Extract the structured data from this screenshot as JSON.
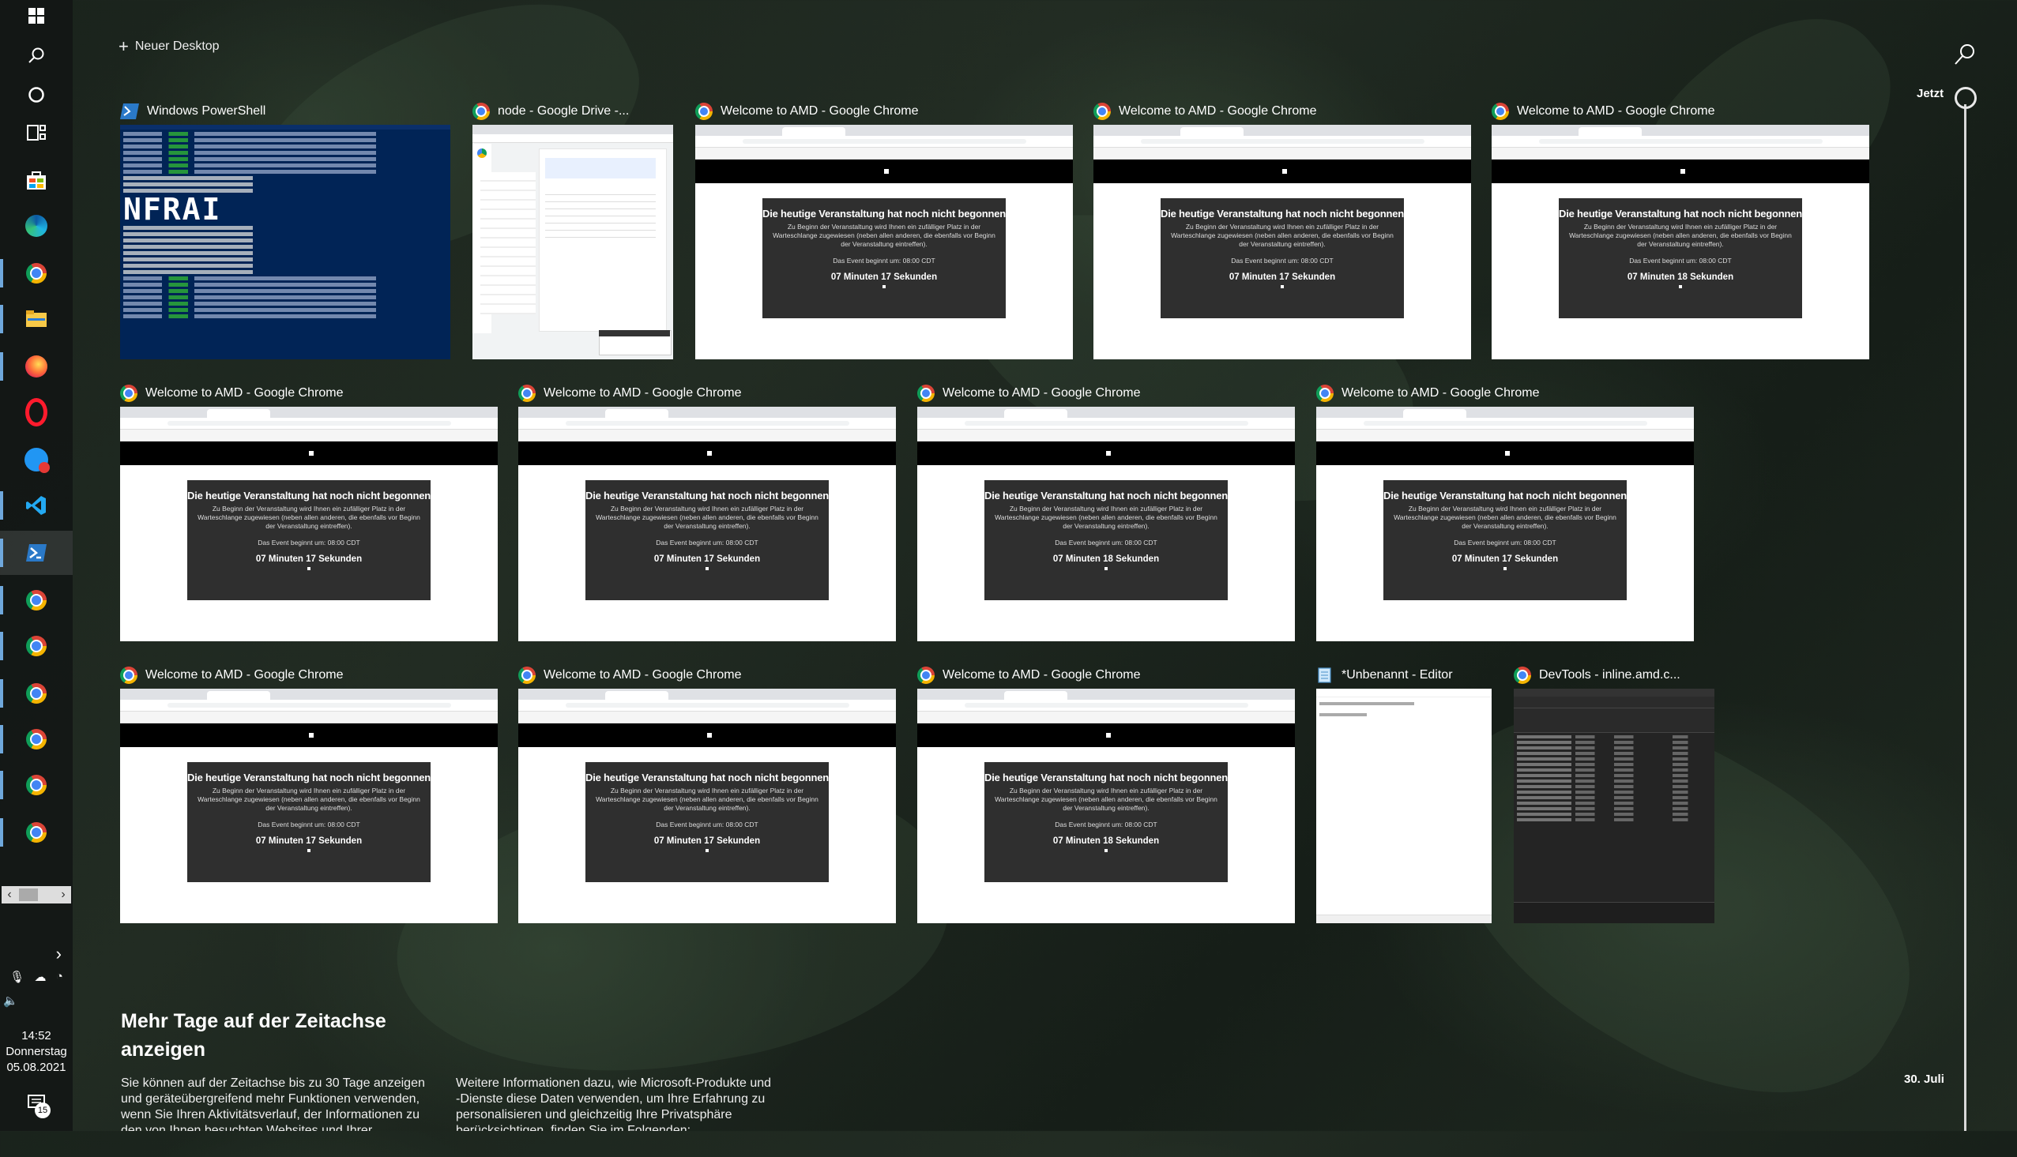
{
  "taskbar": {
    "clock_time": "14:52",
    "clock_day": "Donnerstag",
    "clock_date": "05.08.2021",
    "notification_count": "15"
  },
  "timeline": {
    "new_desktop_label": "Neuer Desktop",
    "now_label": "Jetzt",
    "date_label": "30. Juli"
  },
  "windows": [
    {
      "title": "Windows PowerShell",
      "icon": "powershell-icon"
    },
    {
      "title": "node - Google Drive -...",
      "icon": "chrome-icon"
    },
    {
      "title": "Welcome to AMD - Google Chrome",
      "icon": "chrome-icon"
    },
    {
      "title": "Welcome to AMD - Google Chrome",
      "icon": "chrome-icon"
    },
    {
      "title": "Welcome to AMD - Google Chrome",
      "icon": "chrome-icon"
    },
    {
      "title": "Welcome to AMD - Google Chrome",
      "icon": "chrome-icon"
    },
    {
      "title": "Welcome to AMD - Google Chrome",
      "icon": "chrome-icon"
    },
    {
      "title": "Welcome to AMD - Google Chrome",
      "icon": "chrome-icon"
    },
    {
      "title": "Welcome to AMD - Google Chrome",
      "icon": "chrome-icon"
    },
    {
      "title": "Welcome to AMD - Google Chrome",
      "icon": "chrome-icon"
    },
    {
      "title": "Welcome to AMD - Google Chrome",
      "icon": "chrome-icon"
    },
    {
      "title": "Welcome to AMD - Google Chrome",
      "icon": "chrome-icon"
    },
    {
      "title": "*Unbenannt - Editor",
      "icon": "notepad-icon"
    },
    {
      "title": "DevTools - inline.amd.c...",
      "icon": "chrome-icon"
    }
  ],
  "amd_page": {
    "heading": "Die heutige Veranstaltung hat noch nicht begonnen",
    "paragraph": "Zu Beginn der Veranstaltung wird Ihnen ein zufälliger Platz in der Warteschlange zugewiesen (neben allen anderen, die ebenfalls vor Beginn der Veranstaltung eintreffen).",
    "start": "Das Event beginnt um: 08:00 CDT"
  },
  "countdowns": [
    "07 Minuten 17 Sekunden",
    "07 Minuten 17 Sekunden",
    "07 Minuten 18 Sekunden",
    "07 Minuten 17 Sekunden",
    "07 Minuten 17 Sekunden",
    "07 Minuten 18 Sekunden",
    "07 Minuten 17 Sekunden",
    "07 Minuten 17 Sekunden",
    "07 Minuten 17 Sekunden",
    "07 Minuten 18 Sekunden"
  ],
  "bottom": {
    "title_line1": "Mehr Tage auf der Zeitachse",
    "title_line2": "anzeigen",
    "text_left": "Sie können auf der Zeitachse bis zu 30 Tage anzeigen und geräteübergreifend mehr Funktionen verwenden, wenn Sie Ihren Aktivitätsverlauf, der Informationen zu den von Ihnen besuchten Websites und Ihrer Verwendung von Apps und",
    "text_right": "Weitere Informationen dazu, wie Microsoft-Produkte und -Dienste diese Daten verwenden, um Ihre Erfahrung zu personalisieren und gleichzeitig Ihre Privatsphäre berücksichtigen, finden Sie im Folgenden:"
  },
  "colors": {
    "taskbar_bg": "#121614",
    "timeline_line": "#d8d8d8",
    "amd_box": "#2f2f2f",
    "powershell_bg": "#012456",
    "running_indicator": "#6fa8dc"
  }
}
